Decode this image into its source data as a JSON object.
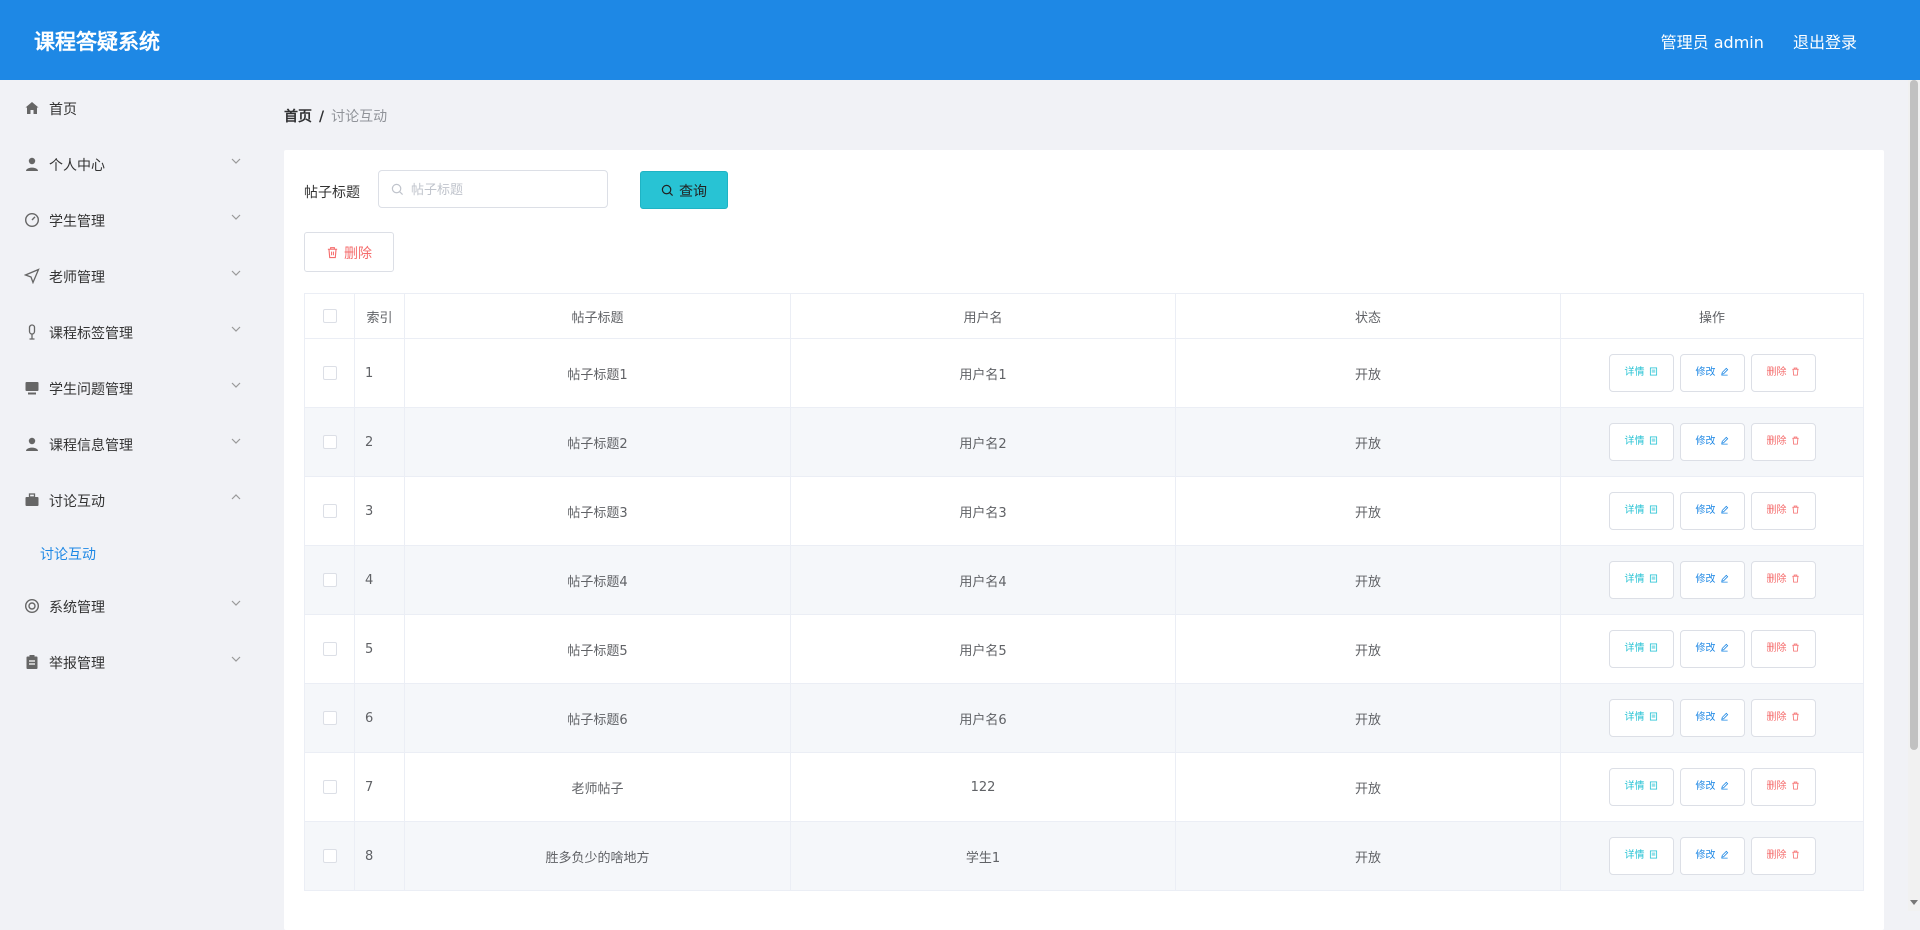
{
  "app": {
    "title": "课程答疑系统"
  },
  "header": {
    "user_label": "管理员 admin",
    "logout_label": "退出登录"
  },
  "sidebar": {
    "items": [
      {
        "label": "首页",
        "icon": "home-icon",
        "has_arrow": false
      },
      {
        "label": "个人中心",
        "icon": "user-icon",
        "has_arrow": true
      },
      {
        "label": "学生管理",
        "icon": "dashboard-icon",
        "has_arrow": true
      },
      {
        "label": "老师管理",
        "icon": "send-icon",
        "has_arrow": true
      },
      {
        "label": "课程标签管理",
        "icon": "microphone-icon",
        "has_arrow": true
      },
      {
        "label": "学生问题管理",
        "icon": "monitor-icon",
        "has_arrow": true
      },
      {
        "label": "课程信息管理",
        "icon": "user-icon",
        "has_arrow": true
      },
      {
        "label": "讨论互动",
        "icon": "suitcase-icon",
        "has_arrow": true,
        "expanded": true
      },
      {
        "label": "系统管理",
        "icon": "lifebuoy-icon",
        "has_arrow": true
      },
      {
        "label": "举报管理",
        "icon": "clipboard-icon",
        "has_arrow": true
      }
    ],
    "submenu": {
      "label": "讨论互动",
      "active_color": "#1e88e5"
    }
  },
  "breadcrumb": {
    "home": "首页",
    "separator": "/",
    "current": "讨论互动"
  },
  "search": {
    "label": "帖子标题",
    "placeholder": "帖子标题",
    "value": "",
    "button_label": "查询"
  },
  "toolbar": {
    "delete_label": "删除"
  },
  "table": {
    "columns": [
      "索引",
      "帖子标题",
      "用户名",
      "状态",
      "操作"
    ],
    "rows": [
      {
        "index": "1",
        "title": "帖子标题1",
        "username": "用户名1",
        "status": "开放"
      },
      {
        "index": "2",
        "title": "帖子标题2",
        "username": "用户名2",
        "status": "开放"
      },
      {
        "index": "3",
        "title": "帖子标题3",
        "username": "用户名3",
        "status": "开放"
      },
      {
        "index": "4",
        "title": "帖子标题4",
        "username": "用户名4",
        "status": "开放"
      },
      {
        "index": "5",
        "title": "帖子标题5",
        "username": "用户名5",
        "status": "开放"
      },
      {
        "index": "6",
        "title": "帖子标题6",
        "username": "用户名6",
        "status": "开放"
      },
      {
        "index": "7",
        "title": "老师帖子",
        "username": "122",
        "status": "开放"
      },
      {
        "index": "8",
        "title": "胜多负少的啥地方",
        "username": "学生1",
        "status": "开放"
      }
    ],
    "actions": {
      "detail": "详情",
      "edit": "修改",
      "delete": "删除"
    }
  },
  "colors": {
    "header": "#1e88e5",
    "query_button": "#28c3d4",
    "danger": "#f56c6c",
    "sidebar_bg": "#f1f2f6"
  }
}
